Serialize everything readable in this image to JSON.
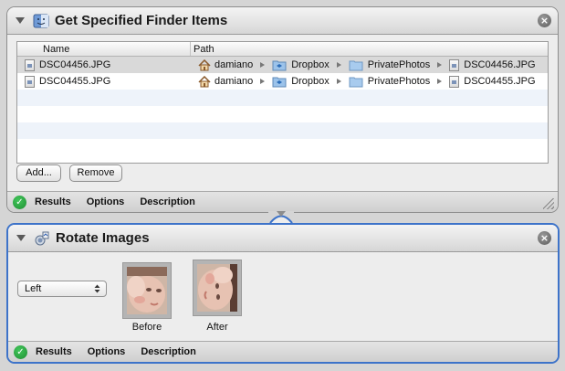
{
  "card1": {
    "title": "Get Specified Finder Items",
    "columns": {
      "name": "Name",
      "path": "Path"
    },
    "rows": [
      {
        "name": "DSC04456.JPG",
        "path": [
          "damiano",
          "Dropbox",
          "PrivatePhotos",
          "DSC04456.JPG"
        ]
      },
      {
        "name": "DSC04455.JPG",
        "path": [
          "damiano",
          "Dropbox",
          "PrivatePhotos",
          "DSC04455.JPG"
        ]
      }
    ],
    "add_label": "Add...",
    "remove_label": "Remove",
    "footer": {
      "results": "Results",
      "options": "Options",
      "description": "Description"
    },
    "close_glyph": "×",
    "check_glyph": "✓"
  },
  "card2": {
    "title": "Rotate Images",
    "select_value": "Left",
    "before_label": "Before",
    "after_label": "After",
    "footer": {
      "results": "Results",
      "options": "Options",
      "description": "Description"
    },
    "close_glyph": "×",
    "check_glyph": "✓"
  },
  "colors": {
    "selection_border": "#3d73c9",
    "status_green": "#1f8f33"
  }
}
